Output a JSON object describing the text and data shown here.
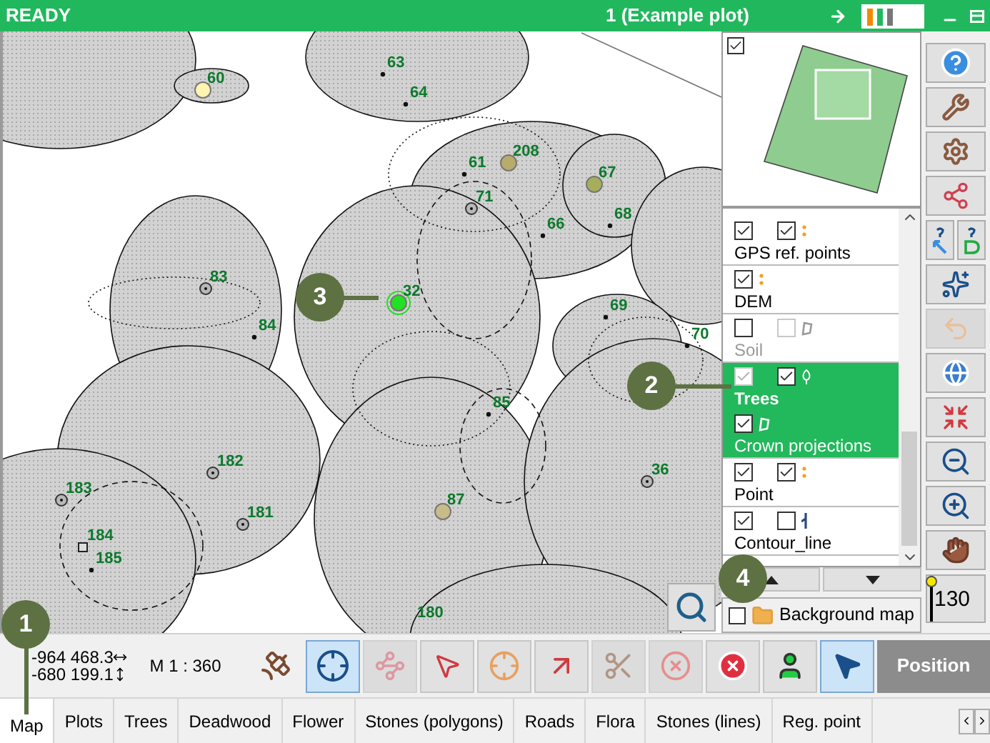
{
  "window": {
    "title": "READY",
    "plot": "1 (Example plot)"
  },
  "map": {
    "trees": [
      {
        "label": "63",
        "kind": "dot",
        "selected": false
      },
      {
        "label": "60",
        "kind": "filled",
        "color": "#fff4b0",
        "selected": false
      },
      {
        "label": "64",
        "kind": "dot",
        "selected": false
      },
      {
        "label": "208",
        "kind": "filled",
        "color": "#b8ab6c",
        "selected": false
      },
      {
        "label": "61",
        "kind": "dot",
        "selected": false
      },
      {
        "label": "67",
        "kind": "filled",
        "color": "#a6ad5c",
        "selected": false
      },
      {
        "label": "71",
        "kind": "ring",
        "selected": false
      },
      {
        "label": "68",
        "kind": "dot",
        "selected": false
      },
      {
        "label": "66",
        "kind": "dot",
        "selected": false
      },
      {
        "label": "83",
        "kind": "ring",
        "selected": false
      },
      {
        "label": "32",
        "kind": "filled",
        "color": "#22e022",
        "selected": true
      },
      {
        "label": "69",
        "kind": "dot",
        "selected": false
      },
      {
        "label": "84",
        "kind": "dot",
        "selected": false
      },
      {
        "label": "70",
        "kind": "dot",
        "selected": false
      },
      {
        "label": "85",
        "kind": "dot",
        "selected": false
      },
      {
        "label": "182",
        "kind": "ring",
        "selected": false
      },
      {
        "label": "36",
        "kind": "ring",
        "selected": false
      },
      {
        "label": "183",
        "kind": "ring",
        "selected": false
      },
      {
        "label": "87",
        "kind": "filled",
        "color": "#c9bb8a",
        "selected": false
      },
      {
        "label": "181",
        "kind": "ring",
        "selected": false
      },
      {
        "label": "184",
        "kind": "square",
        "selected": false
      },
      {
        "label": "185",
        "kind": "dot",
        "selected": false
      },
      {
        "label": "180",
        "kind": "label",
        "selected": false
      }
    ],
    "callouts": [
      "1",
      "2",
      "3",
      "4"
    ]
  },
  "minimap": {
    "checked": true
  },
  "layers": [
    {
      "name": "GPS ref. points",
      "kind": "points",
      "selected": false,
      "disabled": false,
      "checks": [
        {
          "checked": true,
          "disabled": false
        },
        {
          "checked": true,
          "disabled": false
        }
      ]
    },
    {
      "name": "DEM",
      "kind": "points",
      "selected": false,
      "disabled": false,
      "checks": [
        {
          "checked": true,
          "disabled": false
        }
      ]
    },
    {
      "name": "Soil",
      "kind": "polygon",
      "selected": false,
      "disabled": true,
      "checks": [
        {
          "checked": false,
          "disabled": false
        },
        {
          "checked": false,
          "disabled": true
        }
      ]
    },
    {
      "name": "Trees",
      "kind": "tree",
      "selected": true,
      "disabled": false,
      "checks": [
        {
          "checked": true,
          "disabled": true
        },
        {
          "checked": true,
          "disabled": false
        }
      ],
      "children": [
        {
          "name": "Crown projections",
          "kind": "polygon",
          "selected": true,
          "disabled": false,
          "checks": [
            {
              "checked": true,
              "disabled": false
            }
          ]
        }
      ]
    },
    {
      "name": "Point",
      "kind": "points",
      "selected": false,
      "disabled": false,
      "checks": [
        {
          "checked": true,
          "disabled": false
        },
        {
          "checked": true,
          "disabled": false
        }
      ]
    },
    {
      "name": "Contour_line",
      "kind": "line",
      "selected": false,
      "disabled": false,
      "checks": [
        {
          "checked": true,
          "disabled": false
        },
        {
          "checked": false,
          "disabled": false
        }
      ]
    }
  ],
  "background_map": {
    "label": "Background map",
    "checked": false
  },
  "opacity_slider": {
    "level": 1,
    "reading": "130"
  },
  "side_tools": [
    {
      "kind": "help",
      "disabled": false
    },
    {
      "kind": "wrench",
      "disabled": false
    },
    {
      "kind": "gear",
      "disabled": false
    },
    {
      "kind": "export",
      "disabled": false
    },
    {
      "kind": "query-scale",
      "disabled": false
    },
    {
      "kind": "query-dem",
      "disabled": false
    },
    {
      "kind": "select",
      "disabled": false
    },
    {
      "kind": "undo",
      "disabled": true
    },
    {
      "kind": "globe",
      "disabled": false
    },
    {
      "kind": "fit",
      "disabled": false
    },
    {
      "kind": "zoom-out",
      "disabled": false
    },
    {
      "kind": "zoom-in",
      "disabled": false
    },
    {
      "kind": "pan",
      "disabled": false
    }
  ],
  "status": {
    "x": "-964 468.3",
    "y": "-680 199.1",
    "scale": "M 1 : 360"
  },
  "tools": [
    {
      "kind": "satellite",
      "selected": false,
      "disabled": false
    },
    {
      "kind": "target",
      "selected": true,
      "disabled": false
    },
    {
      "kind": "node-edit",
      "selected": false,
      "disabled": true
    },
    {
      "kind": "move-point",
      "selected": false,
      "disabled": false
    },
    {
      "kind": "polygon-point",
      "selected": false,
      "disabled": false
    },
    {
      "kind": "add-point",
      "selected": false,
      "disabled": false
    },
    {
      "kind": "scissors",
      "selected": false,
      "disabled": true
    },
    {
      "kind": "erase",
      "selected": false,
      "disabled": true
    },
    {
      "kind": "remove-point",
      "selected": false,
      "disabled": false
    },
    {
      "kind": "person",
      "selected": false,
      "disabled": false
    },
    {
      "kind": "pointer",
      "selected": true,
      "disabled": false
    }
  ],
  "position_button": "Position",
  "tabs": [
    {
      "label": "Map",
      "selected": true
    },
    {
      "label": "Plots",
      "selected": false
    },
    {
      "label": "Trees",
      "selected": false
    },
    {
      "label": "Deadwood",
      "selected": false
    },
    {
      "label": "Flower",
      "selected": false
    },
    {
      "label": "Stones (polygons)",
      "selected": false
    },
    {
      "label": "Roads",
      "selected": false
    },
    {
      "label": "Flora",
      "selected": false
    },
    {
      "label": "Stones (lines)",
      "selected": false
    },
    {
      "label": "Reg. point",
      "selected": false
    }
  ]
}
